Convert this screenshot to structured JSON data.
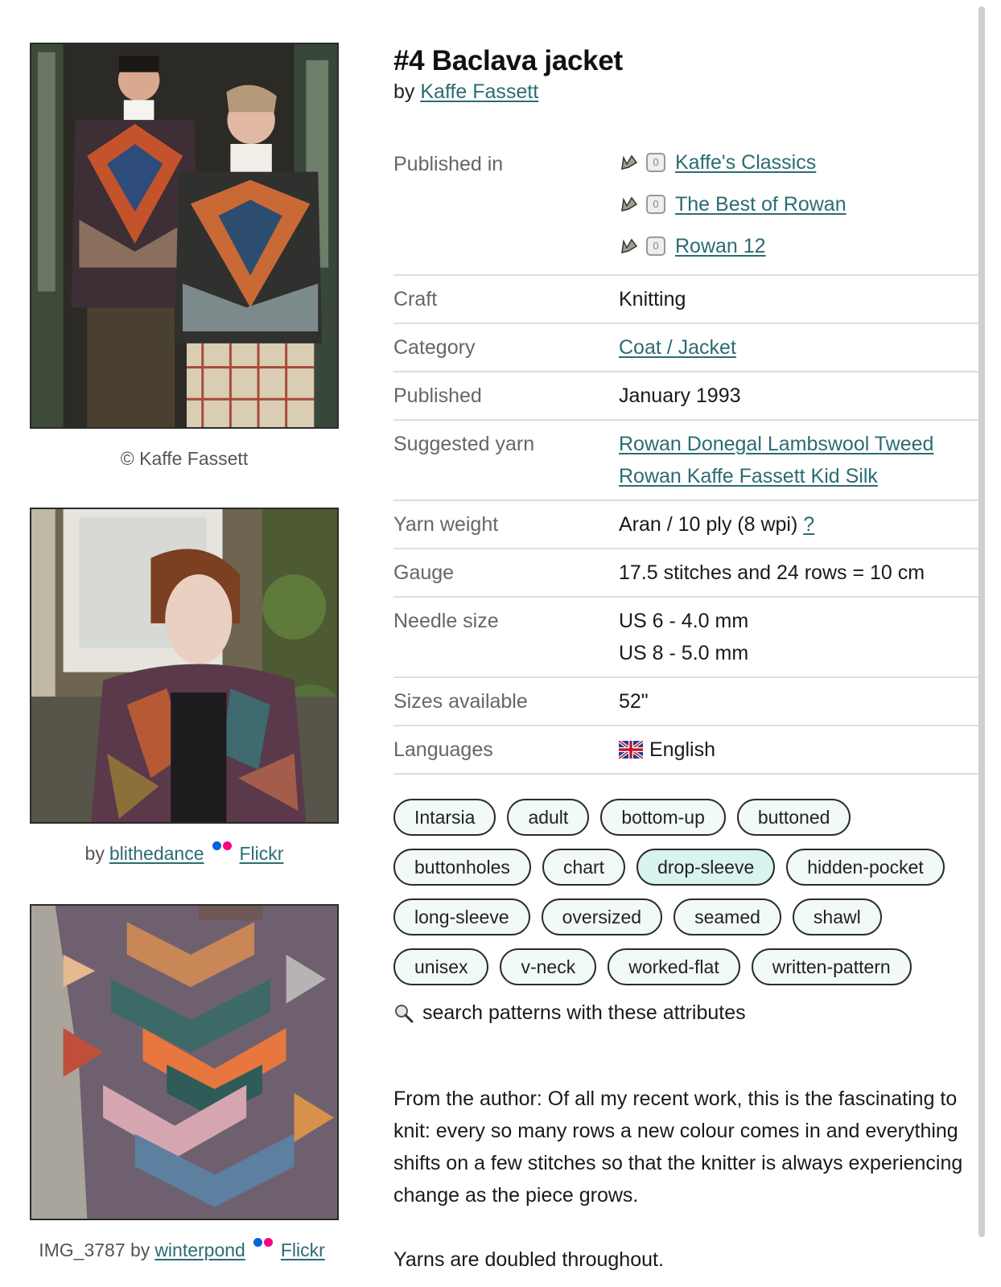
{
  "pattern": {
    "title": "#4 Baclava jacket",
    "by_prefix": "by",
    "designer": "Kaffe Fassett"
  },
  "photos": [
    {
      "caption_text": "© Kaffe Fassett"
    },
    {
      "caption_prefix": "by",
      "user": "blithedance",
      "source": "Flickr"
    },
    {
      "caption_prefix": "IMG_3787 by",
      "user": "winterpond",
      "source": "Flickr"
    }
  ],
  "details": {
    "published_in_label": "Published in",
    "published_in": [
      "Kaffe's Classics",
      "The Best of Rowan",
      "Rowan 12"
    ],
    "craft_label": "Craft",
    "craft": "Knitting",
    "category_label": "Category",
    "category": "Coat / Jacket",
    "published_label": "Published",
    "published": "January 1993",
    "yarn_label": "Suggested yarn",
    "yarns": [
      "Rowan Donegal Lambswool Tweed",
      "Rowan Kaffe Fassett Kid Silk"
    ],
    "weight_label": "Yarn weight",
    "weight": "Aran / 10 ply (8 wpi)",
    "weight_help": "?",
    "gauge_label": "Gauge",
    "gauge": "17.5 stitches and 24 rows = 10 cm",
    "needle_label": "Needle size",
    "needles": [
      "US 6 - 4.0 mm",
      "US 8 - 5.0 mm"
    ],
    "sizes_label": "Sizes available",
    "sizes": "52\"",
    "languages_label": "Languages",
    "language": "English"
  },
  "tags": [
    {
      "label": "Intarsia"
    },
    {
      "label": "adult"
    },
    {
      "label": "bottom-up"
    },
    {
      "label": "buttoned"
    },
    {
      "label": "buttonholes"
    },
    {
      "label": "chart"
    },
    {
      "label": "drop-sleeve",
      "highlighted": true
    },
    {
      "label": "hidden-pocket"
    },
    {
      "label": "long-sleeve"
    },
    {
      "label": "oversized"
    },
    {
      "label": "seamed"
    },
    {
      "label": "shawl"
    },
    {
      "label": "unisex"
    },
    {
      "label": "v-neck"
    },
    {
      "label": "worked-flat"
    },
    {
      "label": "written-pattern"
    }
  ],
  "search_attributes": "search patterns with these attributes",
  "description": [
    "From the author: Of all my recent work, this is the fascinating to knit: every so many rows a new colour comes in and everything shifts on a few stitches so that the knitter is always experiencing change as the piece grows.",
    "Yarns are doubled throughout."
  ],
  "colors": {
    "link": "#2b6c72",
    "tag_bg": "#f1faf8",
    "tag_highlight": "#d9f3ee"
  }
}
